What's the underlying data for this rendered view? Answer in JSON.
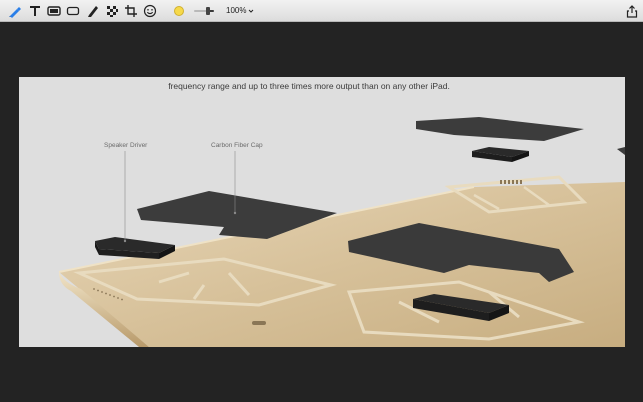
{
  "toolbar": {
    "zoom_value": "100%",
    "tools": [
      {
        "name": "select-tool",
        "icon": "arrow-pen-icon"
      },
      {
        "name": "text-tool",
        "icon": "text-icon"
      },
      {
        "name": "highlight-tool",
        "icon": "highlight-icon"
      },
      {
        "name": "shape-tool",
        "icon": "rectangle-icon"
      },
      {
        "name": "pen-tool",
        "icon": "pen-icon"
      },
      {
        "name": "pixelate-tool",
        "icon": "pixelate-icon"
      },
      {
        "name": "crop-tool",
        "icon": "crop-icon"
      },
      {
        "name": "emoji-tool",
        "icon": "smiley-icon"
      }
    ],
    "color": "#f6d94a",
    "accent": "#2a7fe8"
  },
  "document": {
    "caption": "frequency range and up to three times more output than on any other iPad.",
    "callout_speaker": "Speaker Driver",
    "callout_carbon": "Carbon Fiber Cap"
  }
}
